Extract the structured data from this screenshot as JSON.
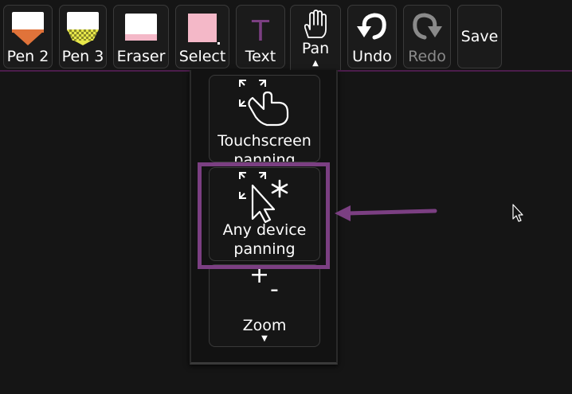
{
  "toolbar": {
    "tools": [
      {
        "name": "pen-2",
        "label": "Pen 2",
        "icon": "pen-2-swatch-icon",
        "color": "#e0733a"
      },
      {
        "name": "pen-3",
        "label": "Pen 3",
        "icon": "pen-3-swatch-icon",
        "color": "#e8e84a"
      },
      {
        "name": "eraser",
        "label": "Eraser",
        "icon": "eraser-swatch-icon",
        "color": "#f4b8c8"
      },
      {
        "name": "select",
        "label": "Select",
        "icon": "select-swatch-icon",
        "color": "#f4b8c8"
      },
      {
        "name": "text",
        "label": "Text",
        "icon": "text-t-icon",
        "glyph": "T",
        "color": "#7b3f82"
      },
      {
        "name": "pan",
        "label": "Pan",
        "icon": "hand-icon"
      },
      {
        "name": "undo",
        "label": "Undo",
        "icon": "undo-arrow-icon"
      },
      {
        "name": "redo",
        "label": "Redo",
        "icon": "redo-arrow-icon",
        "disabled": true
      },
      {
        "name": "save",
        "label": "Save"
      }
    ],
    "accent_color": "#4c1d4c"
  },
  "dropdown": {
    "items": [
      {
        "name": "touchscreen-panning",
        "label_line1": "Touchscreen",
        "label_line2": "panning",
        "icon": "touch-pan-icon"
      },
      {
        "name": "any-device-panning",
        "label_line1": "Any device",
        "label_line2": "panning",
        "icon": "cursor-pan-icon",
        "highlighted": true
      },
      {
        "name": "zoom",
        "label": "Zoom",
        "icon": "zoom-plus-minus-icon",
        "plus": "+",
        "minus": "-"
      }
    ]
  },
  "annotation": {
    "highlight_color": "#7b3f82",
    "arrow_color": "#7b3f82"
  }
}
